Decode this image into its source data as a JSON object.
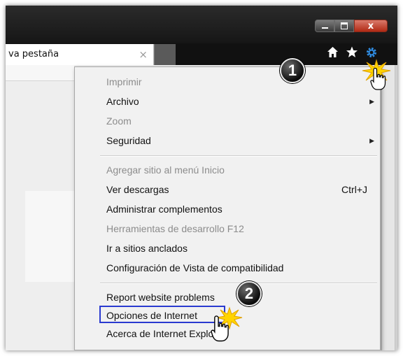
{
  "browser": {
    "tab_title": "va pestaña",
    "tab_close_glyph": "×",
    "toolbar_icons": [
      "home-icon",
      "star-icon",
      "gear-icon"
    ]
  },
  "window_controls": {
    "close_glyph": "x"
  },
  "menu": {
    "items": [
      {
        "label": "Imprimir",
        "disabled": true,
        "submenu": false,
        "shortcut": ""
      },
      {
        "label": "Archivo",
        "disabled": false,
        "submenu": true,
        "shortcut": ""
      },
      {
        "label": "Zoom",
        "disabled": true,
        "submenu": false,
        "shortcut": ""
      },
      {
        "label": "Seguridad",
        "disabled": false,
        "submenu": true,
        "shortcut": ""
      },
      {
        "label": "Agregar sitio al menú Inicio",
        "disabled": true,
        "submenu": false,
        "shortcut": ""
      },
      {
        "label": "Ver descargas",
        "disabled": false,
        "submenu": false,
        "shortcut": "Ctrl+J"
      },
      {
        "label": "Administrar complementos",
        "disabled": false,
        "submenu": false,
        "shortcut": ""
      },
      {
        "label": "Herramientas de desarrollo F12",
        "disabled": true,
        "submenu": false,
        "shortcut": ""
      },
      {
        "label": "Ir a sitios anclados",
        "disabled": false,
        "submenu": false,
        "shortcut": ""
      },
      {
        "label": "Configuración de Vista de compatibilidad",
        "disabled": false,
        "submenu": false,
        "shortcut": ""
      },
      {
        "label": "Report website problems",
        "disabled": false,
        "submenu": false,
        "shortcut": ""
      },
      {
        "label": "Opciones de Internet",
        "disabled": false,
        "submenu": false,
        "shortcut": ""
      },
      {
        "label": "Acerca de Internet Explorer",
        "disabled": false,
        "submenu": false,
        "shortcut": ""
      }
    ]
  },
  "annotations": {
    "step1": "1",
    "step2": "2",
    "highlight_color": "#2a3ad0"
  },
  "colors": {
    "disabled_text": "#8c8c8c",
    "menu_bg": "#f1f1f1",
    "gear_icon": "#2f8be0",
    "close_button": "#c43a22"
  }
}
